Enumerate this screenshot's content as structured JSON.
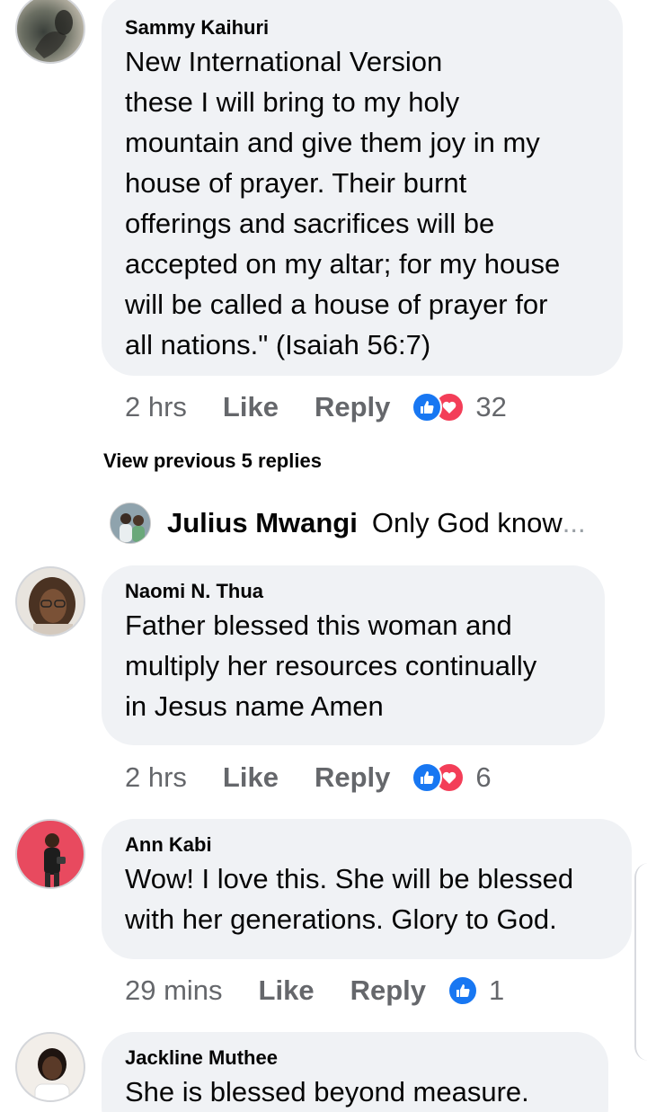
{
  "comments": [
    {
      "author": "Sammy Kaihuri",
      "text": "New International Version\nthese I will bring to my holy\nmountain and give them joy in my\nhouse of prayer. Their burnt\nofferings and sacrifices will be\naccepted on my altar; for my house\nwill be called a house of prayer for\nall nations.\" (Isaiah 56:7)",
      "time": "2 hrs",
      "like_label": "Like",
      "reply_label": "Reply",
      "reaction_count": "32",
      "reactions": [
        "like-icon",
        "love-icon"
      ]
    },
    {
      "author": "Naomi N. Thua",
      "text": "Father blessed this woman and\nmultiply her resources continually\nin Jesus name Amen",
      "time": "2 hrs",
      "like_label": "Like",
      "reply_label": "Reply",
      "reaction_count": "6",
      "reactions": [
        "like-icon",
        "love-icon"
      ]
    },
    {
      "author": "Ann Kabi",
      "text": "Wow! I love this. She will be blessed\nwith her generations. Glory to God.",
      "time": "29 mins",
      "like_label": "Like",
      "reply_label": "Reply",
      "reaction_count": "1",
      "reactions": [
        "like-icon"
      ]
    },
    {
      "author": "Jackline Muthee",
      "text": "She is blessed beyond measure."
    }
  ],
  "view_previous_label": "View previous 5 replies",
  "reply_preview": {
    "author": "Julius Mwangi",
    "text": "Only God know",
    "ellipsis": "..."
  },
  "colors": {
    "like_blue": "#1877f2",
    "love_red": "#f33e58",
    "bubble_bg": "#f0f2f5",
    "meta_gray": "#65676b"
  }
}
